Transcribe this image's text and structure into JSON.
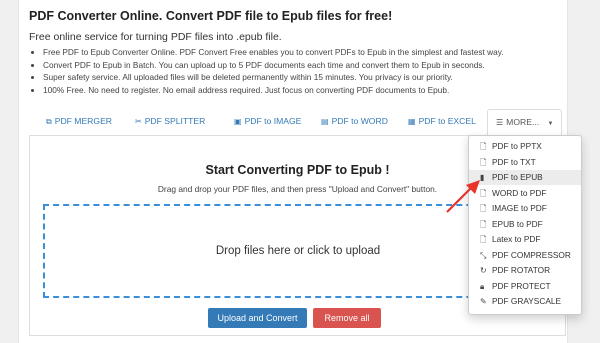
{
  "header": {
    "title": "PDF Converter Online. Convert PDF file to Epub files for free!",
    "subtitle": "Free online service for turning PDF files into .epub file."
  },
  "bullets": [
    "Free PDF to Epub Converter Online. PDF Convert Free enables you to convert PDFs to Epub in the simplest and fastest way.",
    "Convert PDF to Epub in Batch. You can upload up to 5 PDF documents each time and convert them to Epub in seconds.",
    "Super safety service. All uploaded files will be deleted permanently within 15 minutes. You privacy is our priority.",
    "100% Free. No need to register. No email address required. Just focus on converting PDF documents to Epub."
  ],
  "tabs": [
    {
      "label": "PDF MERGER",
      "icon": "merge-icon"
    },
    {
      "label": "PDF SPLITTER",
      "icon": "scissors-icon"
    },
    {
      "label": "PDF to IMAGE",
      "icon": "image-icon"
    },
    {
      "label": "PDF to WORD",
      "icon": "document-icon"
    },
    {
      "label": "PDF to EXCEL",
      "icon": "spreadsheet-icon"
    },
    {
      "label": "MORE...",
      "icon": "list-icon"
    }
  ],
  "panel": {
    "title": "Start Converting PDF to Epub !",
    "subtitle": "Drag and drop your PDF files, and then press \"Upload and Convert\" button.",
    "dropzone": "Drop files here or click to upload",
    "upload_label": "Upload and Convert",
    "remove_label": "Remove all"
  },
  "menu": {
    "active_index": 2,
    "items": [
      {
        "label": "PDF to PPTX",
        "icon": "file-icon"
      },
      {
        "label": "PDF to TXT",
        "icon": "file-icon"
      },
      {
        "label": "PDF to EPUB",
        "icon": "book-icon"
      },
      {
        "label": "WORD to PDF",
        "icon": "file-icon"
      },
      {
        "label": "IMAGE to PDF",
        "icon": "file-icon"
      },
      {
        "label": "EPUB to PDF",
        "icon": "file-icon"
      },
      {
        "label": "Latex to PDF",
        "icon": "file-icon"
      },
      {
        "label": "PDF COMPRESSOR",
        "icon": "compress-icon"
      },
      {
        "label": "PDF ROTATOR",
        "icon": "rotate-icon"
      },
      {
        "label": "PDF PROTECT",
        "icon": "lock-icon"
      },
      {
        "label": "PDF GRAYSCALE",
        "icon": "brush-icon"
      }
    ]
  },
  "colors": {
    "link": "#337ab7",
    "upload_button": "#337ab7",
    "remove_button": "#d9534f",
    "dropzone_border": "#3a8fd8",
    "annotation_arrow": "#e8332a"
  }
}
